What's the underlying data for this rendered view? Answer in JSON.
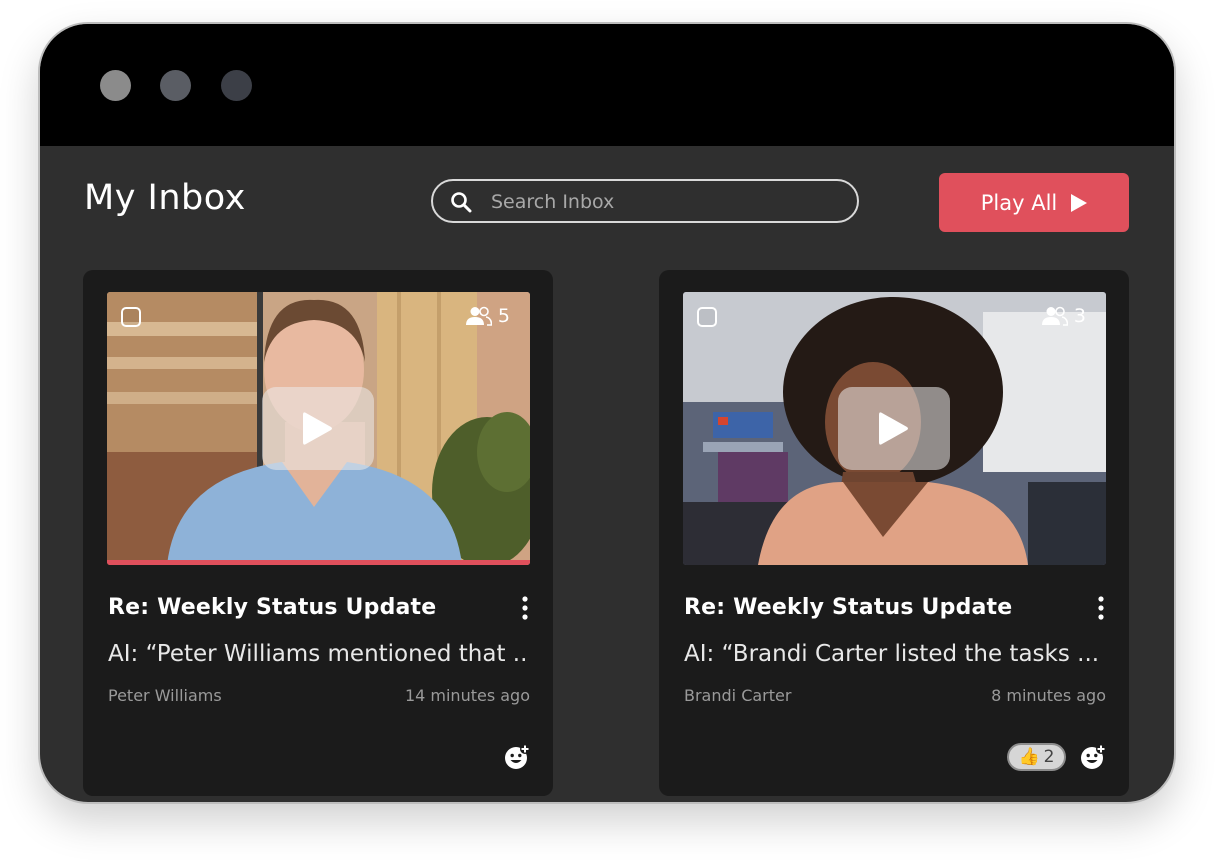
{
  "window": {
    "controls": [
      {
        "name": "close",
        "color": "#8b8b8b"
      },
      {
        "name": "minimize",
        "color": "#5a5d64"
      },
      {
        "name": "maximize",
        "color": "#3c3f47"
      }
    ]
  },
  "header": {
    "title": "My Inbox",
    "search_placeholder": "Search Inbox",
    "search_value": "",
    "play_all_label": "Play All"
  },
  "colors": {
    "accent": "#e0505c",
    "background": "#2f2f2f",
    "card": "#1b1b1b"
  },
  "cards": [
    {
      "viewers": "5",
      "subject": "Re: Weekly Status Update",
      "snippet": "AI: “Peter Williams mentioned that ...",
      "sender": "Peter Williams",
      "time": "14 minutes ago",
      "watched_fraction": 1.0,
      "reactions": []
    },
    {
      "viewers": "3",
      "subject": "Re: Weekly Status Update",
      "snippet": "AI: “Brandi Carter listed the tasks ...",
      "sender": "Brandi Carter",
      "time": "8 minutes ago",
      "watched_fraction": 0,
      "reactions": [
        {
          "emoji": "👍",
          "count": "2"
        }
      ]
    }
  ]
}
